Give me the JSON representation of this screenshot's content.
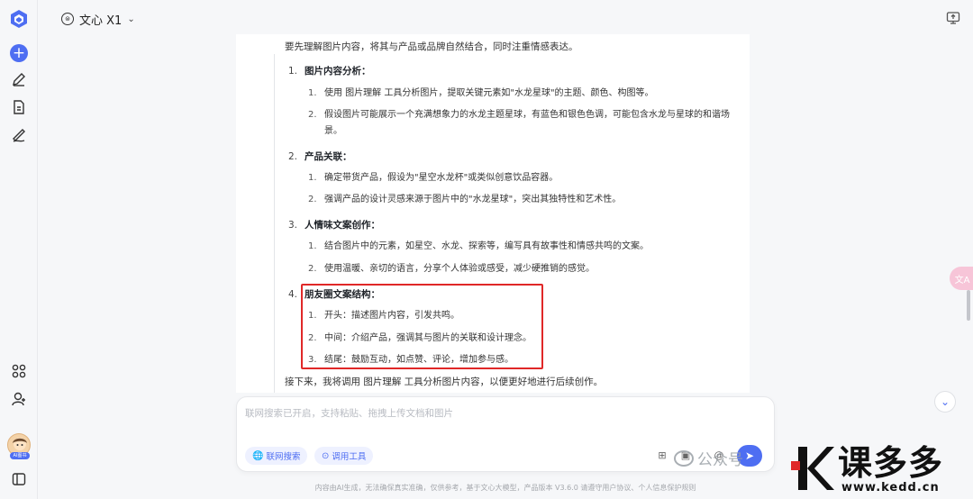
{
  "app": {
    "model_name": "文心 X1",
    "colors": {
      "accent": "#4e6ef2",
      "highlight_box": "#e02828"
    }
  },
  "sidebar": {
    "icons": [
      "logo-icon",
      "new-chat-icon",
      "edit-icon",
      "document-icon",
      "draw-icon",
      "apps-icon",
      "user-icon",
      "avatar",
      "panel-icon"
    ],
    "avatar_badge": "AI图书"
  },
  "content": {
    "intro": "要先理解图片内容，将其与产品或品牌自然结合，同时注重情感表达。",
    "sections": [
      {
        "num": "1.",
        "title": "图片内容分析：",
        "items": [
          {
            "num": "1.",
            "text": "使用 图片理解 工具分析图片，提取关键元素如\"水龙星球\"的主题、颜色、构图等。"
          },
          {
            "num": "2.",
            "text": "假设图片可能展示一个充满想象力的水龙主题星球，有蓝色和银色色调，可能包含水龙与星球的和谐场景。"
          }
        ]
      },
      {
        "num": "2.",
        "title": "产品关联：",
        "items": [
          {
            "num": "1.",
            "text": "确定带货产品，假设为\"星空水龙杯\"或类似创意饮品容器。"
          },
          {
            "num": "2.",
            "text": "强调产品的设计灵感来源于图片中的\"水龙星球\"，突出其独特性和艺术性。"
          }
        ]
      },
      {
        "num": "3.",
        "title": "人情味文案创作：",
        "items": [
          {
            "num": "1.",
            "text": "结合图片中的元素，如星空、水龙、探索等，编写具有故事性和情感共鸣的文案。"
          },
          {
            "num": "2.",
            "text": "使用温暖、亲切的语言，分享个人体验或感受，减少硬推销的感觉。"
          }
        ]
      },
      {
        "num": "4.",
        "title": "朋友圈文案结构：",
        "items": [
          {
            "num": "1.",
            "text": "开头：描述图片内容，引发共鸣。"
          },
          {
            "num": "2.",
            "text": "中间：介绍产品，强调其与图片的关联和设计理念。"
          },
          {
            "num": "3.",
            "text": "结尾：鼓励互动，如点赞、评论，增加参与感。"
          }
        ]
      }
    ],
    "outro": "接下来，我将调用 图片理解 工具分析图片内容，以便更好地进行后续创作。"
  },
  "input": {
    "placeholder": "联网搜索已开启，支持粘贴、拖拽上传文档和图片",
    "web_search_label": "联网搜索",
    "tools_label": "调用工具"
  },
  "footer": "内容由AI生成，无法确保真实准确，仅供参考，基于文心大模型，产品版本 V3.6.0 请遵守用户协议、个人信息保护规则",
  "watermark": {
    "wechat": "公众号",
    "brand": "课多多",
    "url": "www.kedd.cn"
  }
}
